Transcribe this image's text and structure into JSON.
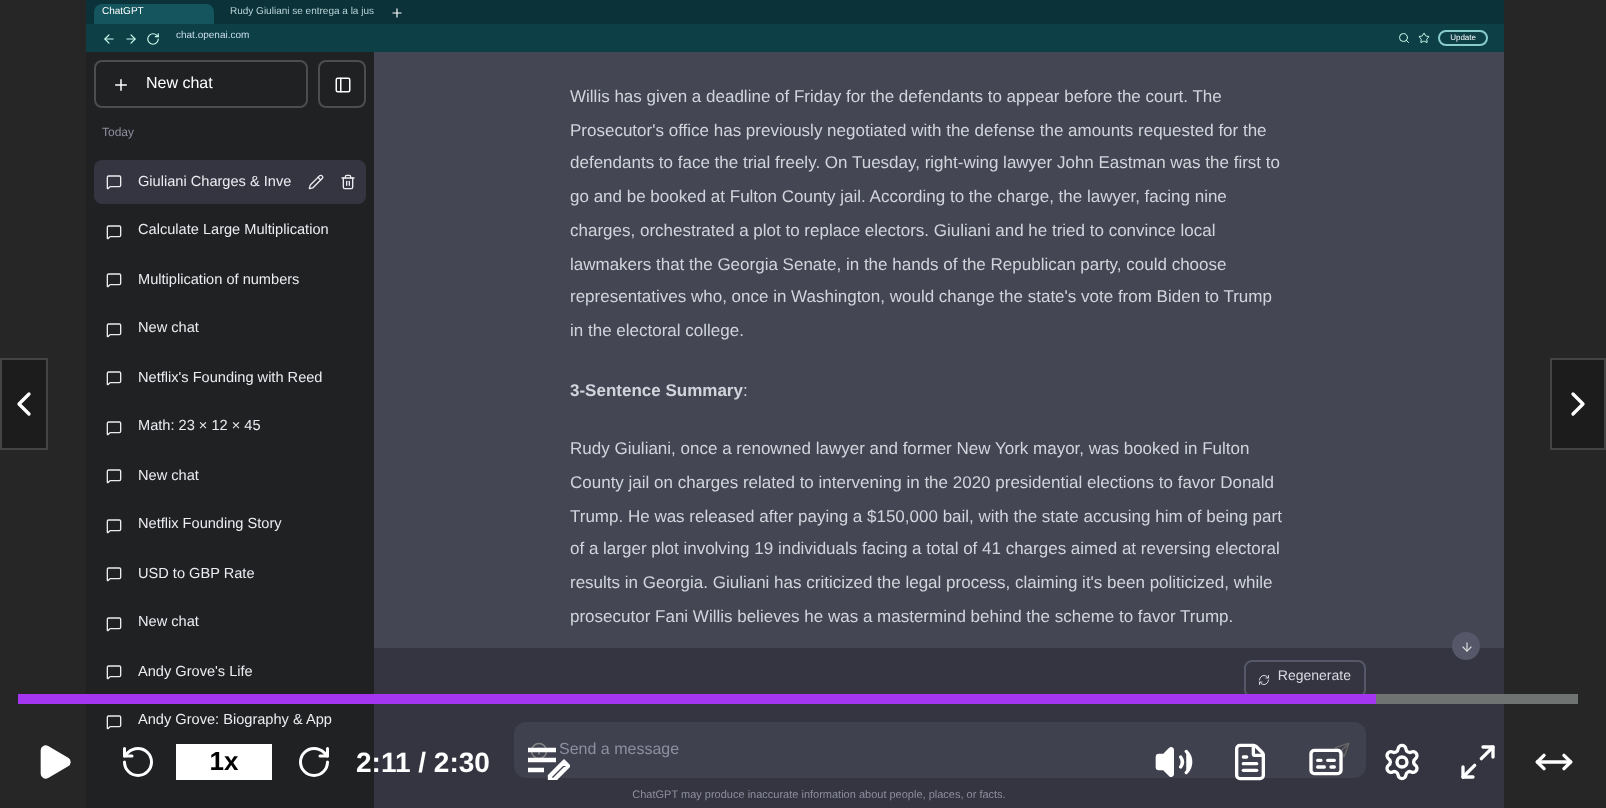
{
  "browser": {
    "tabs": [
      {
        "title": "ChatGPT",
        "selected": true
      },
      {
        "title": "Rudy Giuliani se entrega a la jus",
        "selected": false
      }
    ],
    "address": "chat.openai.com",
    "update_label": "Update"
  },
  "sidebar": {
    "new_chat": "New chat",
    "section": "Today",
    "chats": [
      {
        "title": "Giuliani Charges & Inve",
        "selected": true
      },
      {
        "title": "Calculate Large Multiplication",
        "selected": false
      },
      {
        "title": "Multiplication of numbers",
        "selected": false
      },
      {
        "title": "New chat",
        "selected": false
      },
      {
        "title": "Netflix's Founding with Reed",
        "selected": false
      },
      {
        "title": "Math: 23 × 12 × 45",
        "selected": false
      },
      {
        "title": "New chat",
        "selected": false
      },
      {
        "title": "Netflix Founding Story",
        "selected": false
      },
      {
        "title": "USD to GBP Rate",
        "selected": false
      },
      {
        "title": "New chat",
        "selected": false
      },
      {
        "title": "Andy Grove's Life",
        "selected": false
      },
      {
        "title": "Andy Grove: Biography & App",
        "selected": false
      }
    ]
  },
  "conversation": {
    "paragraphs": [
      "Willis has given a deadline of Friday for the defendants to appear before the court. The Prosecutor's office has previously negotiated with the defense the amounts requested for the defendants to face the trial freely. On Tuesday, right-wing lawyer John Eastman was the first to go and be booked at Fulton County jail. According to the charge, the lawyer, facing nine charges, orchestrated a plot to replace electors. Giuliani and he tried to convince local lawmakers that the Georgia Senate, in the hands of the Republican party, could choose representatives who, once in Washington, would change the state's vote from Biden to Trump in the electoral college.",
      "**3-Sentence Summary**:",
      "Rudy Giuliani, once a renowned lawyer and former New York mayor, was booked in Fulton County jail on charges related to intervening in the 2020 presidential elections to favor Donald Trump. He was released after paying a $150,000 bail, with the state accusing him of being part of a larger plot involving 19 individuals facing a total of 41 charges aimed at reversing electoral results in Georgia. Giuliani has criticized the legal process, claiming it's been politicized, while prosecutor Fani Willis believes he was a mastermind behind the scheme to favor Trump."
    ],
    "regenerate": "Regenerate",
    "composer_placeholder": "Send a message",
    "disclaimer": "ChatGPT may produce inaccurate information about people, places, or facts."
  },
  "player": {
    "playing": false,
    "speed": "1x",
    "time": "2:11 / 2:30",
    "progress": {
      "level": 0.87
    }
  }
}
